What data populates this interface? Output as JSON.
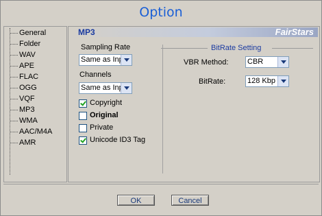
{
  "window": {
    "title": "Option"
  },
  "nav": {
    "items": [
      {
        "label": "General"
      },
      {
        "label": "Folder"
      },
      {
        "label": "WAV"
      },
      {
        "label": "APE"
      },
      {
        "label": "FLAC"
      },
      {
        "label": "OGG"
      },
      {
        "label": "VQF"
      },
      {
        "label": "MP3"
      },
      {
        "label": "WMA"
      },
      {
        "label": "AAC/M4A"
      },
      {
        "label": "AMR"
      }
    ],
    "selected": "MP3"
  },
  "panel": {
    "format_title": "MP3",
    "brand": "FairStars",
    "sampling_rate": {
      "label": "Sampling Rate",
      "value": "Same as Inp"
    },
    "channels": {
      "label": "Channels",
      "value": "Same as Inp"
    },
    "options": [
      {
        "label": "Copyright",
        "checked": true
      },
      {
        "label": "Original",
        "checked": false
      },
      {
        "label": "Private",
        "checked": false
      },
      {
        "label": "Unicode ID3 Tag",
        "checked": true
      }
    ],
    "bitrate_group": {
      "title": "BitRate Setting",
      "vbr_method": {
        "label": "VBR Method:",
        "value": "CBR"
      },
      "bitrate": {
        "label": "BitRate:",
        "value": "128 Kbp"
      }
    }
  },
  "buttons": {
    "ok": "OK",
    "cancel": "Cancel"
  },
  "colors": {
    "title": "#1a5fd6",
    "accent": "#1a3aa0",
    "dialog_bg": "#d4d0c8"
  }
}
